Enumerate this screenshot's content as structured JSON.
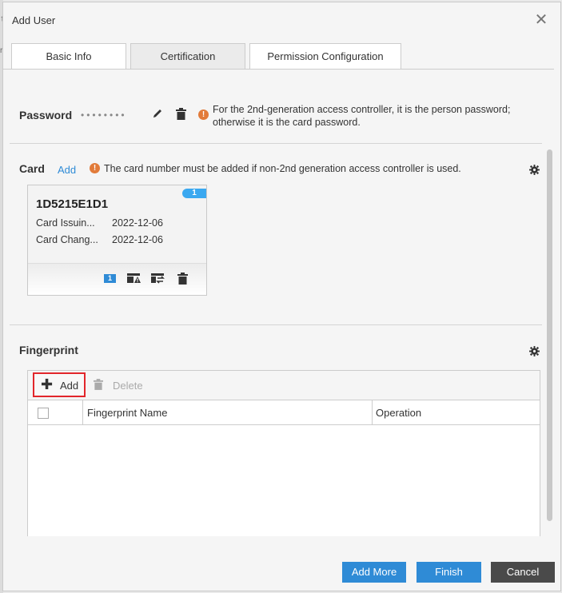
{
  "dialog": {
    "title": "Add User",
    "close_glyph": "✕"
  },
  "background": {
    "edge_glyph_1": "↑",
    "edge_glyph_2": "r"
  },
  "tabs": [
    {
      "label": "Basic Info",
      "active": false
    },
    {
      "label": "Certification",
      "active": true
    },
    {
      "label": "Permission Configuration",
      "active": false
    }
  ],
  "password": {
    "title": "Password",
    "masked_value": "••••••••",
    "note_line1": "For the 2nd-generation access controller, it is the person password;",
    "note_line2": "otherwise it is the card password.",
    "icons": [
      "edit-icon",
      "trash-icon",
      "warning-icon"
    ]
  },
  "card": {
    "title": "Card",
    "add_link": "Add",
    "note": "The card number must be added if non-2nd generation access controller is used.",
    "item": {
      "badge": "1",
      "number": "1D5215E1D1",
      "issue_label": "Card Issuin...",
      "issue_date": "2022-12-06",
      "change_label": "Card Chang...",
      "change_date": "2022-12-06",
      "action_one": "1"
    }
  },
  "fingerprint": {
    "title": "Fingerprint",
    "add_label": "Add",
    "delete_label": "Delete",
    "columns": [
      "Fingerprint Name",
      "Operation"
    ]
  },
  "footer": {
    "add_more": "Add More",
    "finish": "Finish",
    "cancel": "Cancel"
  },
  "colors": {
    "accent": "#2f8bd6",
    "warning": "#e27b3a",
    "highlight_border": "#e2262b",
    "badge": "#3aa8f0",
    "cancel": "#4a4a4a"
  }
}
